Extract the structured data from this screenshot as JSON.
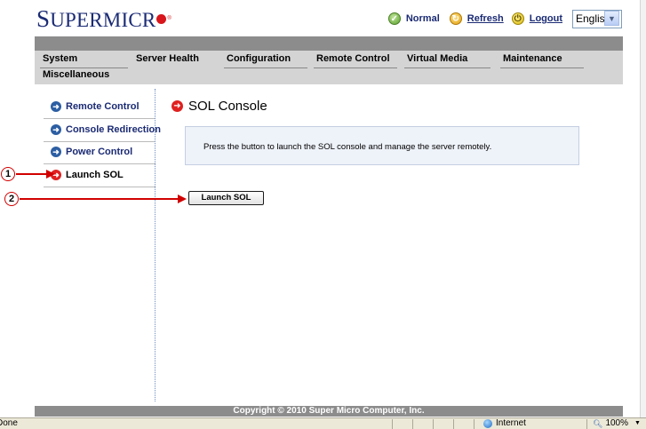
{
  "logo": {
    "first": "S",
    "rest": "UPERMICR",
    "reg": "®"
  },
  "header": {
    "status_label": "Normal",
    "refresh_label": "Refresh",
    "logout_label": "Logout",
    "language": "English"
  },
  "nav": {
    "items": [
      "System",
      "Server Health",
      "Configuration",
      "Remote Control",
      "Virtual Media",
      "Maintenance",
      "Miscellaneous"
    ]
  },
  "sidebar": {
    "items": [
      "Remote Control",
      "Console Redirection",
      "Power Control",
      "Launch SOL"
    ],
    "active": "Launch SOL"
  },
  "main": {
    "title": "SOL Console",
    "description": "Press the button to launch the SOL console and manage the server remotely.",
    "launch_button": "Launch SOL"
  },
  "annotations": {
    "callout1": "1",
    "callout2": "2"
  },
  "footer": {
    "copyright": "Copyright © 2010 Super Micro Computer, Inc."
  },
  "statusbar": {
    "status": "Done",
    "zone": "Internet",
    "zoom": "100%"
  },
  "colors": {
    "brand": "#1b2b74",
    "accent_red": "#d10000",
    "nav_bar": "#8c8c8c",
    "nav_bg": "#d4d4d4"
  }
}
